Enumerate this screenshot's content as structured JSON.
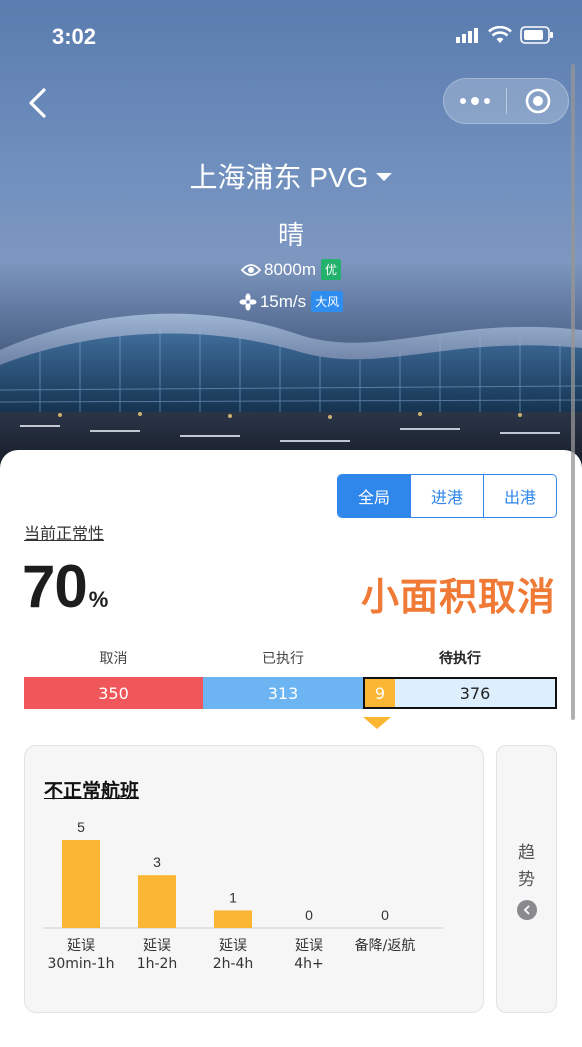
{
  "status_bar": {
    "time": "3:02"
  },
  "header": {
    "airport_name": "上海浦东 PVG",
    "weather": "晴",
    "visibility": "8000m",
    "visibility_grade": "优",
    "wind_speed": "15m/s",
    "wind_grade": "大风"
  },
  "scope_tabs": {
    "items": [
      "全局",
      "进港",
      "出港"
    ],
    "active": 0
  },
  "normality": {
    "label": "当前正常性",
    "value": "70",
    "unit": "%",
    "status": "小面积取消"
  },
  "flight_status": {
    "cancelled": {
      "label": "取消",
      "value": 350
    },
    "executed": {
      "label": "已执行",
      "value": 313
    },
    "pending": {
      "label": "待执行",
      "delayed": 9,
      "rest": 376
    }
  },
  "abnormal_flights": {
    "title": "不正常航班"
  },
  "chart_data": {
    "type": "bar",
    "title": "不正常航班",
    "categories": [
      "延误\n30min-1h",
      "延误\n1h-2h",
      "延误\n2h-4h",
      "延误\n4h+",
      "备降/返航"
    ],
    "values": [
      5,
      3,
      1,
      0,
      0
    ],
    "color": "#fbb634"
  },
  "trend": {
    "label": "趋势"
  },
  "colors": {
    "cancelled": "#f0575a",
    "executed": "#6db5f2",
    "delayed": "#fbb634",
    "pending": "#ddeefd",
    "accent": "#2f86eb",
    "status": "#f07a35"
  }
}
